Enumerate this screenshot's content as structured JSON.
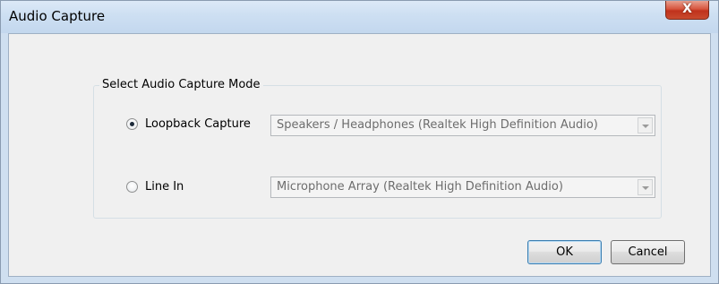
{
  "window": {
    "title": "Audio Capture"
  },
  "titlebar": {
    "close_icon": "close-icon",
    "close_glyph": "X"
  },
  "group": {
    "legend": "Select Audio Capture Mode"
  },
  "loopback": {
    "label": "Loopback Capture",
    "checked": true,
    "device": "Speakers / Headphones (Realtek High Definition Audio)"
  },
  "linein": {
    "label": "Line In",
    "checked": false,
    "device": "Microphone Array (Realtek High Definition Audio)"
  },
  "buttons": {
    "ok": "OK",
    "cancel": "Cancel"
  }
}
